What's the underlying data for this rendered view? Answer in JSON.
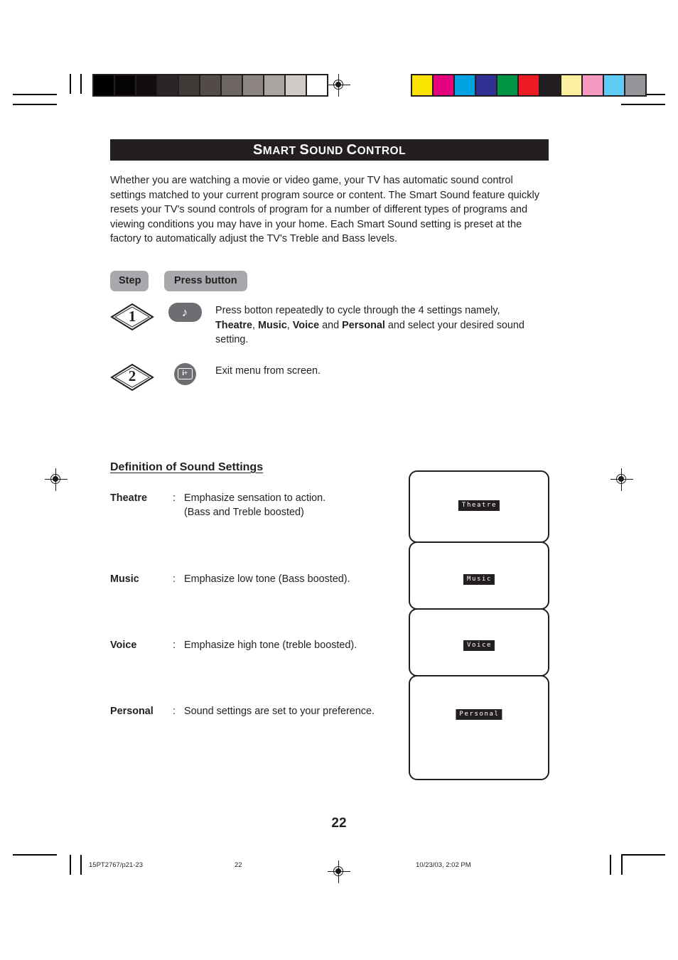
{
  "header": {
    "title_parts": [
      {
        "t": "S",
        "size": "big"
      },
      {
        "t": "MART ",
        "size": "sm"
      },
      {
        "t": "S",
        "size": "big"
      },
      {
        "t": "OUND ",
        "size": "sm"
      },
      {
        "t": "C",
        "size": "big"
      },
      {
        "t": "ONTROL",
        "size": "sm"
      }
    ],
    "title_plain": "SMART SOUND CONTROL"
  },
  "intro": "Whether you are watching a movie or video game, your TV has automatic sound control settings matched to your current program source or content. The Smart Sound feature quickly resets your TV's sound controls of program for a number of different types of programs and viewing conditions you may have in your home. Each Smart Sound setting is preset at the factory to automatically adjust the TV's Treble and Bass levels.",
  "table_headers": {
    "step": "Step",
    "press_button": "Press button"
  },
  "steps": [
    {
      "number": "1",
      "button_icon": "music-note-icon",
      "button_glyph": "♪",
      "text_html": "Press botton repeatedly to cycle through the 4 settings namely, <b>Theatre</b>, <b>Music</b>, <b>Voice</b> and <b>Personal</b> and select your desired sound setting.",
      "text_plain": "Press botton repeatedly to cycle through the 4 settings namely, Theatre, Music, Voice and Personal and select your desired sound setting."
    },
    {
      "number": "2",
      "button_icon": "info-plus-icon",
      "button_glyph": "i+",
      "text_html": "Exit menu from screen.",
      "text_plain": "Exit menu from screen."
    }
  ],
  "definitions": {
    "heading": "Definition of Sound Settings",
    "items": [
      {
        "name": "Theatre",
        "colon": ":",
        "desc": "Emphasize sensation to action.",
        "desc2": "(Bass and Treble boosted)"
      },
      {
        "name": "Music",
        "colon": ":",
        "desc": "Emphasize low tone (Bass boosted).",
        "desc2": ""
      },
      {
        "name": "Voice",
        "colon": ":",
        "desc": "Emphasize high tone (treble boosted).",
        "desc2": ""
      },
      {
        "name": "Personal",
        "colon": ":",
        "desc": "Sound settings are set to your preference.",
        "desc2": ""
      }
    ]
  },
  "screens": [
    {
      "osd_label": "Theatre"
    },
    {
      "osd_label": "Music"
    },
    {
      "osd_label": "Voice"
    },
    {
      "osd_label": "Personal"
    }
  ],
  "page_number": "22",
  "footer": {
    "file": "15PT2767/p21-23",
    "page": "22",
    "timestamp": "10/23/03, 2:02 PM"
  },
  "calibration": {
    "grayscale": [
      "#000000",
      "#050304",
      "#140d0d",
      "#2a2526",
      "#403a39",
      "#524b48",
      "#6d6662",
      "#8b8481",
      "#a9a49f",
      "#cfcbc7",
      "#ffffff"
    ],
    "colors": [
      "#fae300",
      "#e5007e",
      "#00a3e0",
      "#2e3192",
      "#009444",
      "#ed1c24",
      "#231f20",
      "#fbefa0",
      "#f49ac1",
      "#61cbf3",
      "#939598"
    ]
  }
}
